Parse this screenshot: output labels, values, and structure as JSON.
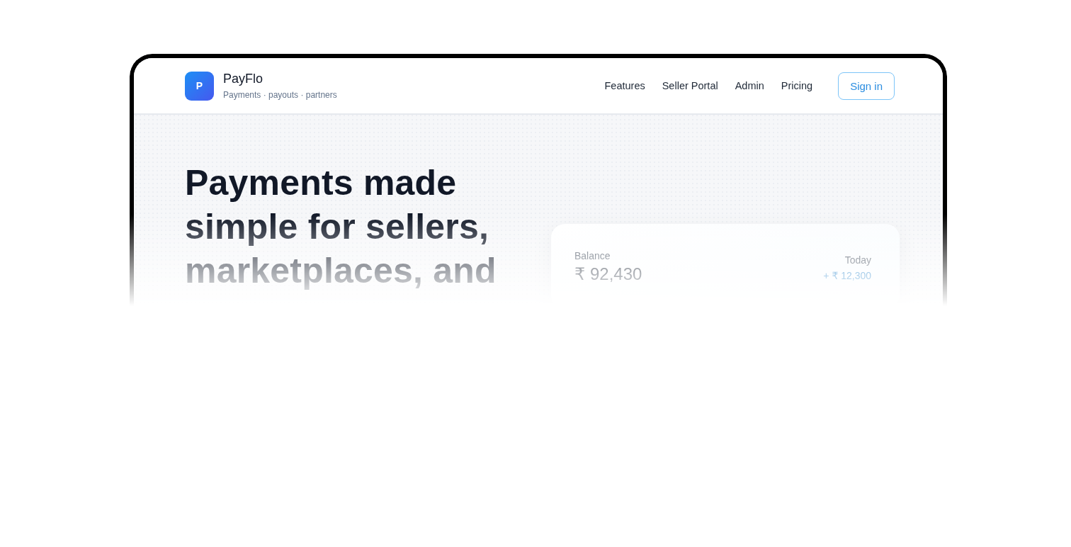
{
  "brand": {
    "logo_letter": "P",
    "name": "PayFlo",
    "tagline": "Payments · payouts · partners"
  },
  "nav": {
    "links": [
      "Features",
      "Seller Portal",
      "Admin",
      "Pricing"
    ],
    "button": "Sign in"
  },
  "hero": {
    "title": "Payments made simple for sellers, marketplaces, and",
    "balance_card": {
      "label": "Balance",
      "amount": "₹ 92,430",
      "today_label": "Today",
      "today_change": "+ ₹ 12,300"
    }
  }
}
